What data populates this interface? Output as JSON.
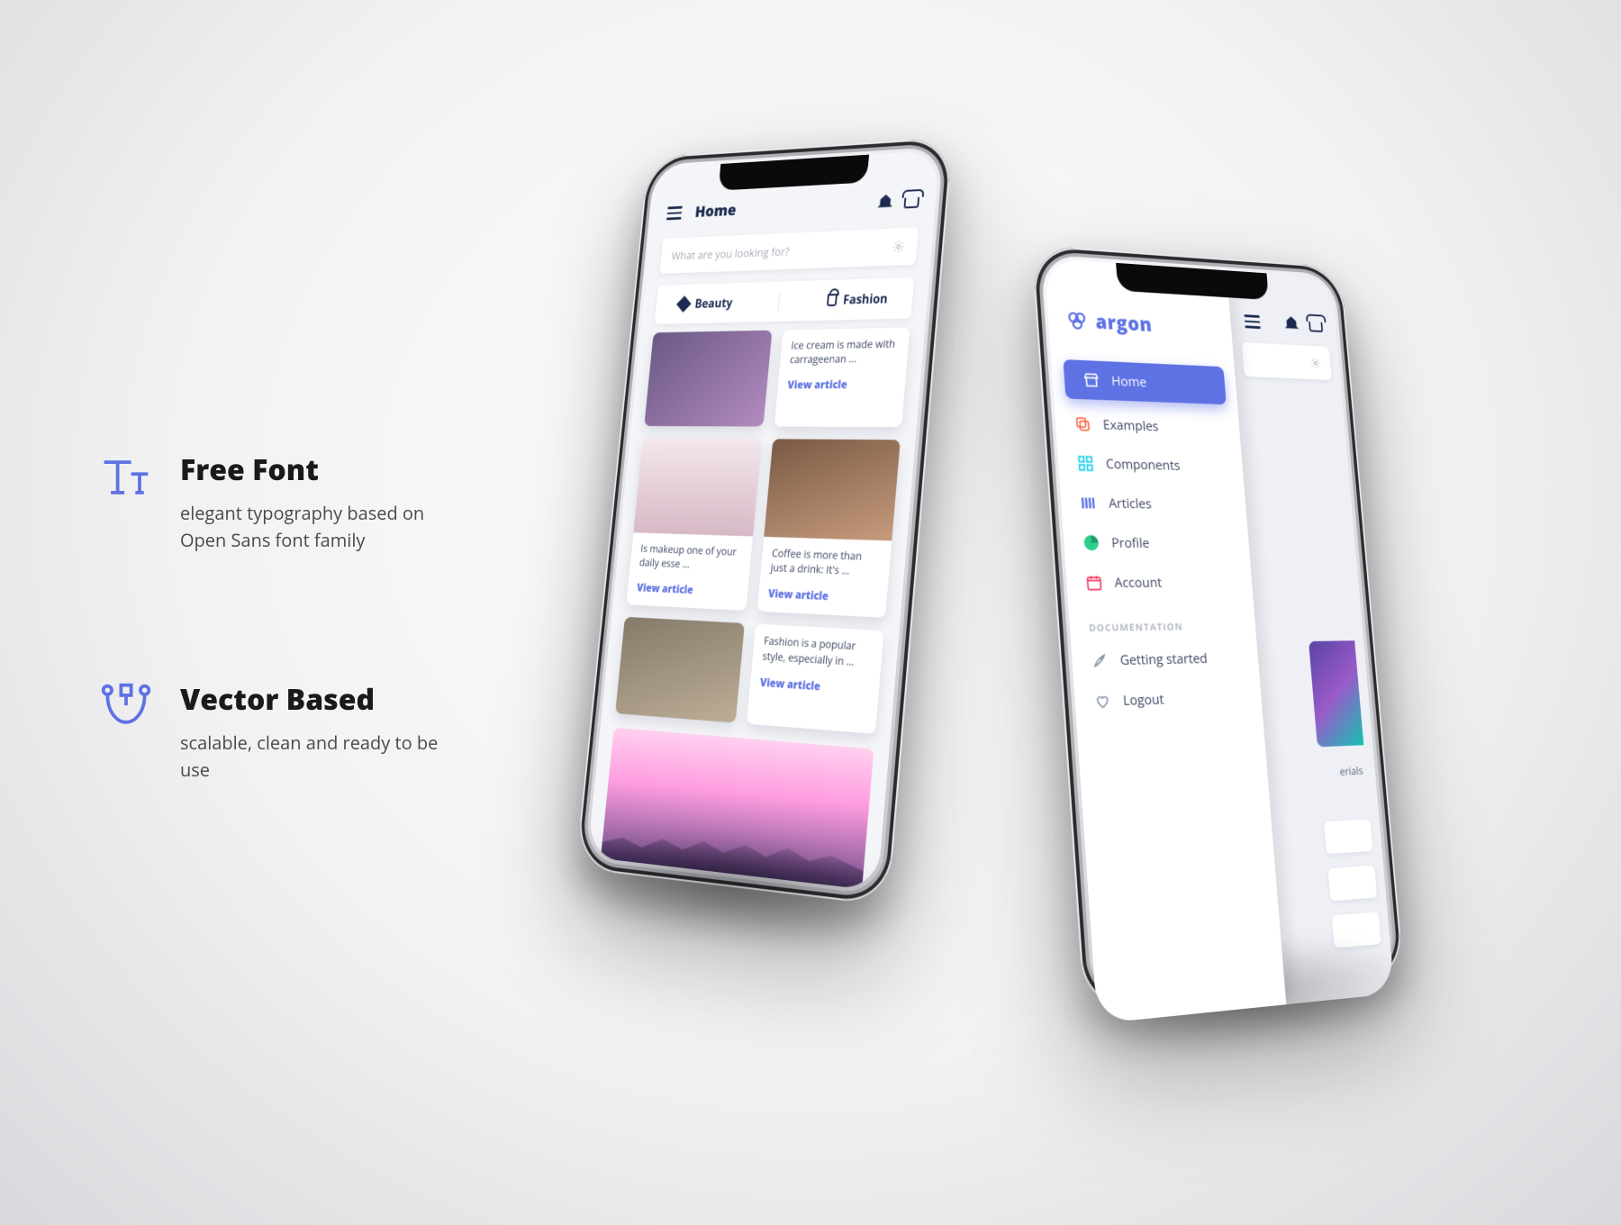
{
  "marketing": {
    "features": [
      {
        "title": "Free Font",
        "desc": "elegant typography based on Open Sans font family"
      },
      {
        "title": "Vector Based",
        "desc": "scalable, clean and ready to be use"
      }
    ]
  },
  "colors": {
    "primary": "#5e72e4",
    "ink": "#1b2a4e"
  },
  "phone1": {
    "page_title": "Home",
    "search_placeholder": "What are you looking for?",
    "chips": {
      "beauty": "Beauty",
      "fashion": "Fashion"
    },
    "view_label": "View article",
    "cards": [
      {
        "text": "Ice cream is made with carrageenan …"
      },
      {
        "text": "Is makeup one of your daily esse …"
      },
      {
        "text": "Coffee is more than just a drink: It's …"
      },
      {
        "text": "Fashion is a popular style, especially in …"
      }
    ]
  },
  "phone2": {
    "brand": "argon",
    "nav": [
      {
        "label": "Home",
        "active": true
      },
      {
        "label": "Examples"
      },
      {
        "label": "Components"
      },
      {
        "label": "Articles"
      },
      {
        "label": "Profile"
      },
      {
        "label": "Account"
      }
    ],
    "doc_group_label": "DOCUMENTATION",
    "doc_items": [
      {
        "label": "Getting started"
      },
      {
        "label": "Logout"
      }
    ],
    "peek_caption": "erials"
  }
}
